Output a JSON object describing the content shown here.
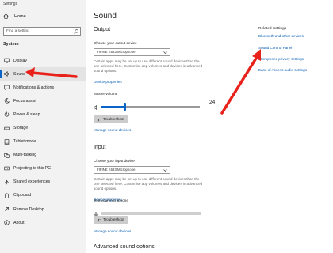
{
  "window": {
    "title": "Settings"
  },
  "sidebar": {
    "home_label": "Home",
    "search_placeholder": "Find a setting",
    "section_title": "System",
    "items": [
      {
        "label": "Display",
        "icon": "display-icon"
      },
      {
        "label": "Sound",
        "icon": "speaker-icon",
        "active": true
      },
      {
        "label": "Notifications & actions",
        "icon": "notifications-icon"
      },
      {
        "label": "Focus assist",
        "icon": "moon-icon"
      },
      {
        "label": "Power & sleep",
        "icon": "power-icon"
      },
      {
        "label": "Storage",
        "icon": "storage-icon"
      },
      {
        "label": "Tablet mode",
        "icon": "tablet-icon"
      },
      {
        "label": "Multi-tasking",
        "icon": "multitasking-icon"
      },
      {
        "label": "Projecting to this PC",
        "icon": "projecting-icon"
      },
      {
        "label": "Shared experiences",
        "icon": "shared-icon"
      },
      {
        "label": "Clipboard",
        "icon": "clipboard-icon"
      },
      {
        "label": "Remote Desktop",
        "icon": "remote-desktop-icon"
      },
      {
        "label": "About",
        "icon": "info-icon"
      }
    ]
  },
  "main": {
    "title": "Sound",
    "output": {
      "heading": "Output",
      "device_label": "Choose your output device",
      "device_value": "FIFINE K683 Microphone",
      "description": "Certain apps may be set up to use different sound devices than the one selected here. Customise app volumes and devices in advanced sound options.",
      "device_properties_link": "Device properties",
      "master_volume_label": "Master volume",
      "volume": 24,
      "troubleshoot_label": "Troubleshoot",
      "manage_link": "Manage sound devices"
    },
    "input": {
      "heading": "Input",
      "device_label": "Choose your input device",
      "device_value": "FIFINE K683 Microphone",
      "description": "Certain apps may be set up to use different sound devices than the one selected here. Customise app volumes and devices in advanced sound options.",
      "device_properties_link": "Device properties",
      "test_label": "Test your microphone",
      "troubleshoot_label": "Troubleshoot",
      "manage_link": "Manage sound devices"
    },
    "advanced_heading": "Advanced sound options"
  },
  "related": {
    "title": "Related Settings",
    "links": [
      "Bluetooth and other devices",
      "Sound Control Panel",
      "Microphone privacy settings",
      "Ease of Access audio settings"
    ]
  },
  "colors": {
    "accent": "#0a64c8",
    "link": "#0a5fb4",
    "arrow": "#e8221b",
    "sidebar_bg": "#f2f2f2"
  }
}
